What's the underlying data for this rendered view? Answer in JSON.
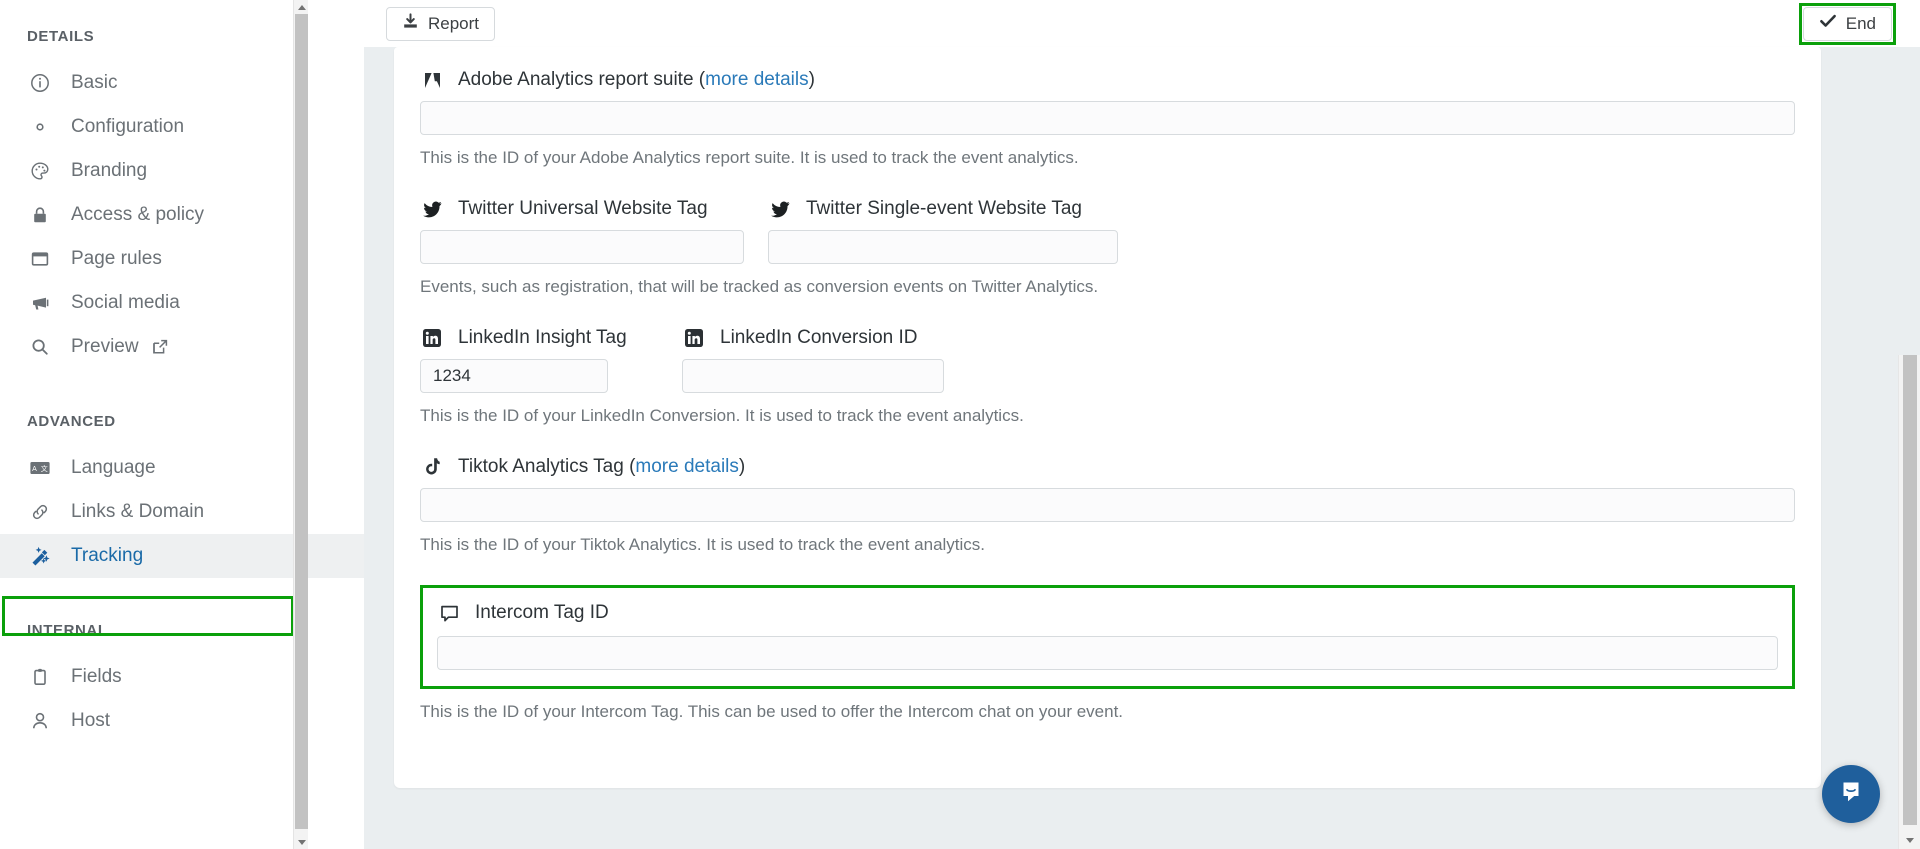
{
  "sidebar": {
    "sections": [
      {
        "title": "DETAILS",
        "items": [
          {
            "label": "Basic",
            "icon": "info-circle-icon"
          },
          {
            "label": "Configuration",
            "icon": "gear-icon"
          },
          {
            "label": "Branding",
            "icon": "palette-icon"
          },
          {
            "label": "Access & policy",
            "icon": "lock-icon"
          },
          {
            "label": "Page rules",
            "icon": "window-icon"
          },
          {
            "label": "Social media",
            "icon": "megaphone-icon"
          },
          {
            "label": "Preview",
            "icon": "search-icon",
            "trailing_icon": "external-link-icon"
          }
        ]
      },
      {
        "title": "ADVANCED",
        "items": [
          {
            "label": "Language",
            "icon": "translate-icon"
          },
          {
            "label": "Links & Domain",
            "icon": "link-icon"
          },
          {
            "label": "Tracking",
            "icon": "magic-wand-icon",
            "active": true
          }
        ]
      },
      {
        "title": "INTERNAL",
        "items": [
          {
            "label": "Fields",
            "icon": "clipboard-icon"
          },
          {
            "label": "Host",
            "icon": "user-icon"
          }
        ]
      }
    ]
  },
  "toolbar": {
    "report_label": "Report",
    "report_icon": "download-icon",
    "end_label": "End",
    "end_icon": "check-icon"
  },
  "form": {
    "adobe": {
      "label": "Adobe Analytics report suite",
      "icon": "adobe-analytics-icon",
      "more_details": "more details",
      "value": "",
      "helper": "This is the ID of your Adobe Analytics report suite. It is used to track the event analytics."
    },
    "twitter_universal": {
      "label": "Twitter Universal Website Tag",
      "icon": "twitter-icon",
      "value": ""
    },
    "twitter_single": {
      "label": "Twitter Single-event Website Tag",
      "icon": "twitter-icon",
      "value": ""
    },
    "twitter_helper": "Events, such as registration, that will be tracked as conversion events on Twitter Analytics.",
    "linkedin_insight": {
      "label": "LinkedIn Insight Tag",
      "icon": "linkedin-icon",
      "value": "1234"
    },
    "linkedin_conversion": {
      "label": "LinkedIn Conversion ID",
      "icon": "linkedin-icon",
      "value": ""
    },
    "linkedin_helper": "This is the ID of your LinkedIn Conversion. It is used to track the event analytics.",
    "tiktok": {
      "label": "Tiktok Analytics Tag",
      "icon": "tiktok-icon",
      "more_details": "more details",
      "value": "",
      "helper": "This is the ID of your Tiktok Analytics. It is used to track the event analytics."
    },
    "intercom": {
      "label": "Intercom Tag ID",
      "icon": "chat-bubble-icon",
      "value": "",
      "helper": "This is the ID of your Intercom Tag. This can be used to offer the Intercom chat on your event."
    }
  },
  "widgets": {
    "intercom_launcher_icon": "intercom-chat-icon"
  },
  "colors": {
    "annotation_green": "#0ba00b",
    "link_blue": "#2a7ab9",
    "active_blue": "#1a6aa8",
    "page_bg": "#eaeef0",
    "intercom_blue": "#1f5f9c"
  }
}
